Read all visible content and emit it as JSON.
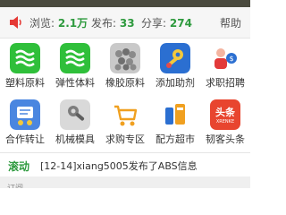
{
  "stats": {
    "views_label": "浏览:",
    "views_value": "2.1万",
    "posts_label": "发布:",
    "posts_value": "33",
    "shares_label": "分享:",
    "shares_value": "274",
    "help_label": "帮助"
  },
  "grid": [
    {
      "label": "塑料原料",
      "icon": "green-waves-icon",
      "color": "#2fbf3a"
    },
    {
      "label": "弹性体料",
      "icon": "green-waves-icon",
      "color": "#2fbf3a"
    },
    {
      "label": "橡胶原料",
      "icon": "rubber-pellets-icon",
      "color": "#9a9a9a"
    },
    {
      "label": "添加助剂",
      "icon": "wrench-gear-icon",
      "color": "#2b6fd1"
    },
    {
      "label": "求职招聘",
      "icon": "job-recruit-icon",
      "color": "#e23a3a"
    },
    {
      "label": "合作转让",
      "icon": "cooperation-icon",
      "color": "#3a78d6"
    },
    {
      "label": "机械模具",
      "icon": "machine-mold-icon",
      "color": "#8a8a8a"
    },
    {
      "label": "求购专区",
      "icon": "shopping-cart-icon",
      "color": "#f0a020"
    },
    {
      "label": "配方超市",
      "icon": "formula-icon",
      "color": "#2b6fd1"
    },
    {
      "label": "韧客头条",
      "icon": "news-icon",
      "color": "#e8452f"
    }
  ],
  "grid_extra": {
    "news_badge_text": "头条",
    "news_badge_sub": "XRENKE"
  },
  "ticker": {
    "tag": "滚动",
    "text": "[12-14]xiang5005发布了ABS信息"
  },
  "bottom": {
    "label": "订阅"
  }
}
